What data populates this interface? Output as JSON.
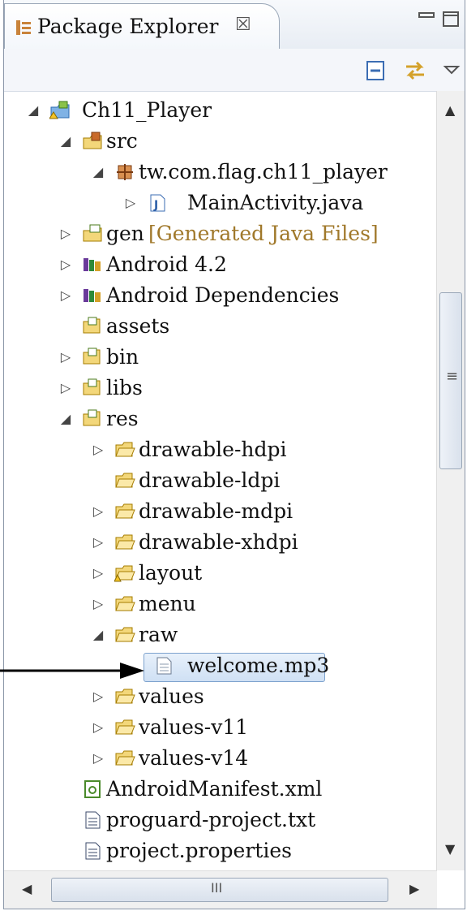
{
  "tab": {
    "title": "Package Explorer",
    "close_glyph": "☒"
  },
  "tree": {
    "rows": [
      {
        "label": "Ch11_Player",
        "icon": "android-project-icon"
      },
      {
        "label": "src",
        "icon": "source-folder-icon"
      },
      {
        "label": "tw.com.flag.ch11_player",
        "icon": "package-icon"
      },
      {
        "label": "MainActivity.java",
        "icon": "java-file-icon"
      },
      {
        "label": "gen",
        "decoration": "[Generated Java Files]",
        "icon": "source-folder-icon"
      },
      {
        "label": "Android 4.2",
        "icon": "library-icon"
      },
      {
        "label": "Android Dependencies",
        "icon": "library-icon"
      },
      {
        "label": "assets",
        "icon": "folder-icon"
      },
      {
        "label": "bin",
        "icon": "folder-icon"
      },
      {
        "label": "libs",
        "icon": "folder-icon"
      },
      {
        "label": "res",
        "icon": "folder-icon"
      },
      {
        "label": "drawable-hdpi",
        "icon": "folder-icon"
      },
      {
        "label": "drawable-ldpi",
        "icon": "folder-icon"
      },
      {
        "label": "drawable-mdpi",
        "icon": "folder-icon"
      },
      {
        "label": "drawable-xhdpi",
        "icon": "folder-icon"
      },
      {
        "label": "layout",
        "icon": "folder-icon"
      },
      {
        "label": "menu",
        "icon": "folder-icon"
      },
      {
        "label": "raw",
        "icon": "folder-icon"
      },
      {
        "label": "welcome.mp3",
        "icon": "file-icon",
        "selected": true
      },
      {
        "label": "values",
        "icon": "folder-icon"
      },
      {
        "label": "values-v11",
        "icon": "folder-icon"
      },
      {
        "label": "values-v14",
        "icon": "folder-icon"
      },
      {
        "label": "AndroidManifest.xml",
        "icon": "manifest-icon"
      },
      {
        "label": "proguard-project.txt",
        "icon": "text-file-icon"
      },
      {
        "label": "project.properties",
        "icon": "text-file-icon"
      }
    ]
  },
  "scroll": {
    "grip_glyph": "≡",
    "hgrip_glyph": "III"
  },
  "colors": {
    "accent": "#7da2ce",
    "decoration": "#a0782a"
  }
}
